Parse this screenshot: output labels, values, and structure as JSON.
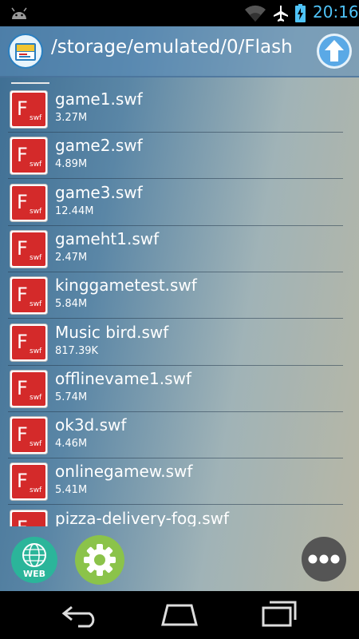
{
  "status_bar": {
    "time": "20:16",
    "icons": [
      "android-icon",
      "wifi-icon",
      "airplane-icon",
      "battery-charging-icon"
    ]
  },
  "header": {
    "path": "/storage/emulated/0/Flash",
    "app_icon": "app-icon",
    "up_icon": "up-arrow-icon"
  },
  "files": [
    {
      "name": "game1.swf",
      "size": "3.27M"
    },
    {
      "name": "game2.swf",
      "size": "4.89M"
    },
    {
      "name": "game3.swf",
      "size": "12.44M"
    },
    {
      "name": "gameht1.swf",
      "size": "2.47M"
    },
    {
      "name": "kinggametest.swf",
      "size": "5.84M"
    },
    {
      "name": "Music bird.swf",
      "size": "817.39K"
    },
    {
      "name": "offlinevame1.swf",
      "size": "5.74M"
    },
    {
      "name": "ok3d.swf",
      "size": "4.46M"
    },
    {
      "name": "onlinegamew.swf",
      "size": "5.41M"
    },
    {
      "name": "pizza-delivery-fog.swf",
      "size": ""
    }
  ],
  "file_icon": {
    "letter": "F",
    "sub": "swf"
  },
  "toolbar": {
    "web_label": "WEB",
    "icons": [
      "web-globe-icon",
      "gear-icon",
      "more-icon"
    ]
  },
  "colors": {
    "swf_red": "#d42a2a",
    "clock_blue": "#4fc3f7",
    "settings_green": "#8bc34a",
    "web_teal": "#2bb59a"
  },
  "nav_icons": [
    "back-icon",
    "home-icon",
    "recents-icon"
  ]
}
